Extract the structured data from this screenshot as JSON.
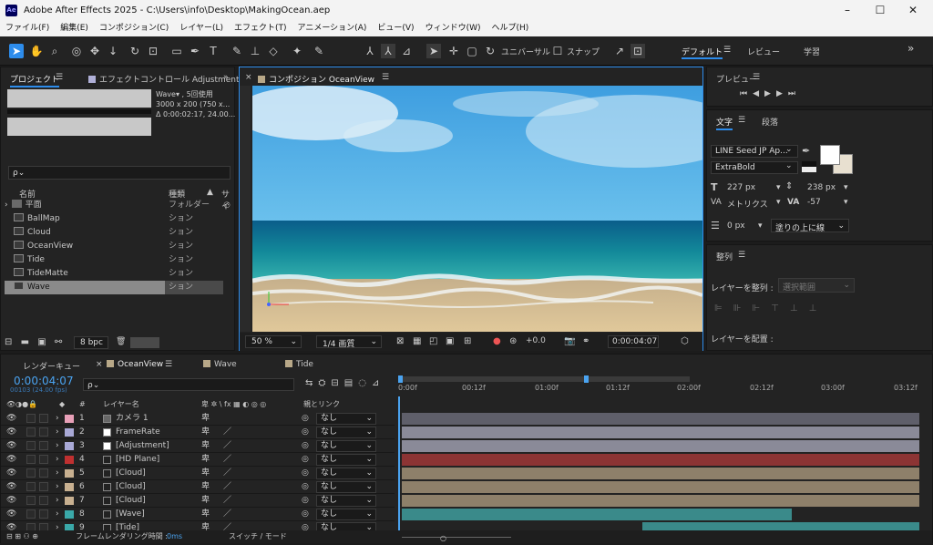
{
  "window": {
    "title": "Adobe After Effects 2025 - C:\\Users\\info\\Desktop\\MakingOcean.aep",
    "app_icon": "Ae",
    "minimize": "–",
    "maximize": "☐",
    "close": "✕"
  },
  "menu": [
    "ファイル(F)",
    "編集(E)",
    "コンポジション(C)",
    "レイヤー(L)",
    "エフェクト(T)",
    "アニメーション(A)",
    "ビュー(V)",
    "ウィンドウ(W)",
    "ヘルプ(H)"
  ],
  "toolbar": {
    "universal": "ユニバーサル",
    "snap": "スナップ",
    "workspaces": [
      "デフォルト",
      "レビュー",
      "学習"
    ],
    "more": "»"
  },
  "project": {
    "tab": "プロジェクト",
    "tab2": "エフェクトコントロール Adjustment",
    "info": [
      "Wave▾ , 5回使用",
      "3000 x 200 (750 x...",
      "Δ 0:00:02:17, 24.00..."
    ],
    "search": "ρ⌄",
    "col_name": "名前",
    "col_kind": "種類",
    "col_size": "サイ",
    "items": [
      {
        "name": "平面",
        "kind": "フォルダー"
      },
      {
        "name": "BallMap",
        "kind": "ション"
      },
      {
        "name": "Cloud",
        "kind": "ション"
      },
      {
        "name": "OceanView",
        "kind": "ション"
      },
      {
        "name": "Tide",
        "kind": "ション"
      },
      {
        "name": "TideMatte",
        "kind": "ション"
      },
      {
        "name": "Wave",
        "kind": "ション"
      }
    ],
    "bpc": "8 bpc"
  },
  "comp": {
    "tab": "コンポジション OceanView",
    "zoom": "50 %",
    "quality": "1/4 画質",
    "exposure": "+0.0",
    "time": "0:00:04:07"
  },
  "preview": {
    "tab": "プレビュー"
  },
  "text": {
    "tab": "文字",
    "tab2": "段落",
    "font": "LINE Seed JP Ap...",
    "style": "ExtraBold",
    "size": "227 px",
    "leading": "238 px",
    "kerning": "メトリクス",
    "tracking": "-57",
    "stroke_w": "0 px",
    "stroke_mode": "塗りの上に線"
  },
  "align": {
    "tab": "整列",
    "label": "レイヤーを整列 :",
    "target": "選択範囲",
    "distribute": "レイヤーを配置 :"
  },
  "timeline": {
    "tabs": [
      "レンダーキュー",
      "OceanView",
      "Wave",
      "Tide"
    ],
    "timecode": "0:00:04:07",
    "fps": "00103 (24.00 fps)",
    "search": "ρ⌄",
    "col_layer": "レイヤー名",
    "col_sw": "卑 ✲ \\ fx ▦ ◐ ◎ ◎",
    "col_parent": "親とリンク",
    "ruler": [
      "0:00f",
      "00:12f",
      "01:00f",
      "01:12f",
      "02:00f",
      "02:12f",
      "03:00f",
      "03:12f"
    ],
    "layers": [
      {
        "n": "1",
        "name": "カメラ 1",
        "label": "#e8a0b8",
        "parent": "なし",
        "bar": "#5f5f6a"
      },
      {
        "n": "2",
        "name": "FrameRate",
        "label": "#a9a9d6",
        "parent": "なし",
        "bar": "#8a8a98"
      },
      {
        "n": "3",
        "name": "[Adjustment]",
        "label": "#a9a9d6",
        "parent": "なし",
        "bar": "#8a8a98"
      },
      {
        "n": "4",
        "name": "[HD Plane]",
        "label": "#c03030",
        "parent": "なし",
        "bar": "#8c3434"
      },
      {
        "n": "5",
        "name": "[Cloud]",
        "label": "#c8b090",
        "parent": "なし",
        "bar": "#8e806a"
      },
      {
        "n": "6",
        "name": "[Cloud]",
        "label": "#c8b090",
        "parent": "なし",
        "bar": "#8e806a"
      },
      {
        "n": "7",
        "name": "[Cloud]",
        "label": "#c8b090",
        "parent": "なし",
        "bar": "#8e806a"
      },
      {
        "n": "8",
        "name": "[Wave]",
        "label": "#3aa8a8",
        "parent": "なし",
        "bar": "#3a8a8a"
      },
      {
        "n": "9",
        "name": "[Tide]",
        "label": "#3aa8a8",
        "parent": "なし",
        "bar": "#3a8a8a"
      }
    ],
    "status": "フレームレンダリング時間 :",
    "render_ms": "0ms",
    "switch_mode": "スイッチ / モード"
  },
  "colors": {
    "accent": "#2d8ceb",
    "panel": "#232323"
  }
}
